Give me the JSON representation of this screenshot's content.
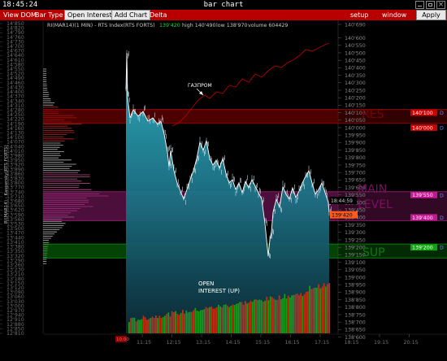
{
  "window": {
    "clock": "18:45:24",
    "title": "bar chart"
  },
  "menu": {
    "view_dom": "View DOM",
    "bar_type": "Bar Type",
    "open_interest": "Open Interest",
    "add_chart": "Add Chart",
    "delta": "Delta",
    "setup": "setup",
    "window": "window",
    "apply": "Apply"
  },
  "chart_data": {
    "type": "line",
    "header": "RI(MAR14)(1 MIN) - RTS Index(RTS FORTS)",
    "last_price": "139'420",
    "high": "high 140'490",
    "low": "low 138'970",
    "volume": "volume 604429",
    "rotated_label": "RI(MAR14) - Kaspersky(RTS FORTS)",
    "price_ticks": [
      "140'690",
      "140'600",
      "140'550",
      "140'500",
      "140'450",
      "140'400",
      "140'350",
      "140'300",
      "140'250",
      "140'200",
      "140'150",
      "140'100",
      "140'050",
      "140'000",
      "139'950",
      "139'900",
      "139'850",
      "139'800",
      "139'750",
      "139'700",
      "139'650",
      "139'600",
      "139'550",
      "139'500",
      "139'450",
      "139'400",
      "139'350",
      "139'300",
      "139'250",
      "139'200",
      "139'150",
      "139'100",
      "139'050",
      "139'000",
      "138'950",
      "138'900",
      "138'850",
      "138'800",
      "138'750",
      "138'700",
      "138'650",
      "138'600"
    ],
    "left_ticks": [
      "14'850",
      "14'820",
      "14'790",
      "14'760",
      "14'730",
      "14'700",
      "14'670",
      "14'640",
      "14'610",
      "14'580",
      "14'550",
      "14'520",
      "14'490",
      "14'460",
      "14'430",
      "14'400",
      "14'370",
      "14'340",
      "14'310",
      "14'280",
      "14'250",
      "14'220",
      "14'190",
      "14'160",
      "14'130",
      "14'100",
      "14'070",
      "14'040",
      "14'010",
      "13'980",
      "13'950",
      "13'920",
      "13'890",
      "13'860",
      "13'830",
      "13'800",
      "13'770",
      "13'740",
      "13'710",
      "13'680",
      "13'650",
      "13'620",
      "13'590",
      "13'560",
      "13'530",
      "13'500",
      "13'470",
      "13'440",
      "13'410",
      "13'380",
      "13'350",
      "13'320",
      "13'290",
      "13'260",
      "13'230",
      "13'210",
      "13'180",
      "13'150",
      "13'120",
      "13'090",
      "13'060",
      "13'030",
      "13'000",
      "12'970",
      "12'940",
      "12'910",
      "12'880",
      "12'850",
      "12'810"
    ],
    "time_labels": [
      "11:15",
      "12:15",
      "13:15",
      "14:15",
      "15:15",
      "16:15",
      "17:15",
      "18:15",
      "19:15",
      "20:15"
    ],
    "start_label": "10:00",
    "zones": [
      {
        "name": "RES",
        "color": "#8b0000",
        "from": "140'050",
        "to": "140'100"
      },
      {
        "name": "MAIN LEVEL",
        "color": "#8b1a6b",
        "from": "139'400",
        "to": "139'550"
      },
      {
        "name": "SUP",
        "color": "#0a7a0a",
        "from": "139'150",
        "to": "139'200"
      }
    ],
    "tags": [
      "140'100",
      "140'000",
      "139'550",
      "139'400",
      "139'200"
    ],
    "time_tag": "18:44:59",
    "labels": {
      "gazprom": "ГАЗПРОМ",
      "oi_line1": "OPEN",
      "oi_line2": "INTEREST (UP)",
      "res": "RES",
      "main_level_1": "MAIN",
      "main_level_2": "LEVEL",
      "sup": "SUP",
      "d": "D"
    },
    "colors": {
      "price_line": "#ffffff",
      "area_top": "#2aa3b8",
      "gazprom": "#b00000",
      "oi_up": "#c03018",
      "oi_down": "#1a9a1a"
    }
  }
}
